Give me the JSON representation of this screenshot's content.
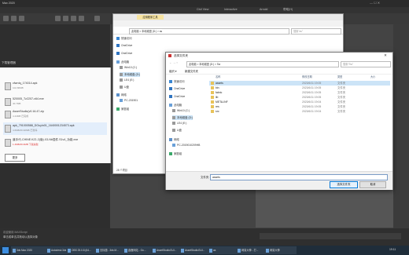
{
  "max": {
    "title": "Max 2020",
    "menus": [
      "Civil View",
      "Interactive",
      "Arnold",
      "帮助(H)"
    ],
    "left_header": "下载管理器",
    "bottom_status": "单击或单击并拖动以选择对象",
    "bottom_status2": "欢迎使用 MAXScript",
    "colors": {
      "viewport": "#555555",
      "pink": "#e070c8"
    }
  },
  "downloads": {
    "items": [
      {
        "name": "cfwrdq_174014.apk",
        "meta": "102.80MB",
        "red": false
      },
      {
        "name": "520005_Tz2207-x64.exe",
        "meta": "40.7MB",
        "red": false
      },
      {
        "name": "AsserStudio(v0.16.47.zip",
        "meta": "4.44MB 已完成",
        "red": false
      },
      {
        "name": "apk_791000588_DOuyin01_1640001234573.apk",
        "meta": "4.6MB/46.90MB 已暂停",
        "red": false
      },
      {
        "name": "道手代-CHINE.KZ1.2(版).X3-Nb插件.S1v4_功能.exe",
        "meta": "1.4MB/46.9MB 下载失败",
        "red": true
      }
    ],
    "more_label": "更多"
  },
  "explorer": {
    "ribbon_tab": "应用程序工具",
    "title_path": "此电脑 > 本地磁盘 (D:) > as",
    "search_placeholder": "搜索\"as\"",
    "nav": [
      "快速访问",
      "OneDrive",
      "OneDrive",
      "此电脑",
      "Win10 (C:)",
      "本地磁盘 (D:)",
      "LE4 (E:)",
      "U盘",
      "网络",
      "PC-201901",
      "家庭组"
    ],
    "status": "28 个项目"
  },
  "dialog": {
    "title": "选择文件夹",
    "close": "✕",
    "path": "此电脑 > 本地磁盘 (D:) > Sw",
    "search_placeholder": "搜索\"Sw\"",
    "toolbar_org": "组织 ▾",
    "toolbar_new": "新建文件夹",
    "nav": [
      "快速访问",
      "OneDrive",
      "OneDrive",
      "此电脑",
      "Win10 (C:)",
      "本地磁盘 (D:)",
      "LE4 (E:)",
      "U盘",
      "网络",
      "PC-2019010209HB",
      "家庭组"
    ],
    "columns": {
      "name": "名称",
      "date": "修改日期",
      "type": "类型",
      "size": "大小"
    },
    "files": [
      {
        "name": "assets",
        "date": "2023/6/11 19:05",
        "type": "文件夹",
        "selected": true
      },
      {
        "name": "bin",
        "date": "2023/6/11 19:05",
        "type": "文件夹",
        "selected": false
      },
      {
        "name": "fabric",
        "date": "2023/6/11 19:05",
        "type": "文件夹",
        "selected": false
      },
      {
        "name": "lib",
        "date": "2023/6/11 19:05",
        "type": "文件夹",
        "selected": false
      },
      {
        "name": "META-INF",
        "date": "2023/6/11 19:04",
        "type": "文件夹",
        "selected": false
      },
      {
        "name": "res",
        "date": "2023/6/11 19:05",
        "type": "文件夹",
        "selected": false
      },
      {
        "name": "src",
        "date": "2023/6/11 19:04",
        "type": "文件夹",
        "selected": false
      }
    ],
    "filename_label": "文件夹:",
    "filename_value": "assets",
    "select_button": "选择文件夹",
    "cancel_button": "取消"
  },
  "taskbar": {
    "items": [
      "3ds Max 2020",
      "Autodesk 3ds Max...",
      "OBS 25.0.8 (64...",
      "无标题 - 3ds M...",
      "鑫鹿网站 - Go...",
      "AssetStudioGUI...",
      "AssetStudioGUI...",
      "as",
      "网易大神 - 打...",
      "网易大神"
    ],
    "time": "19:11"
  }
}
